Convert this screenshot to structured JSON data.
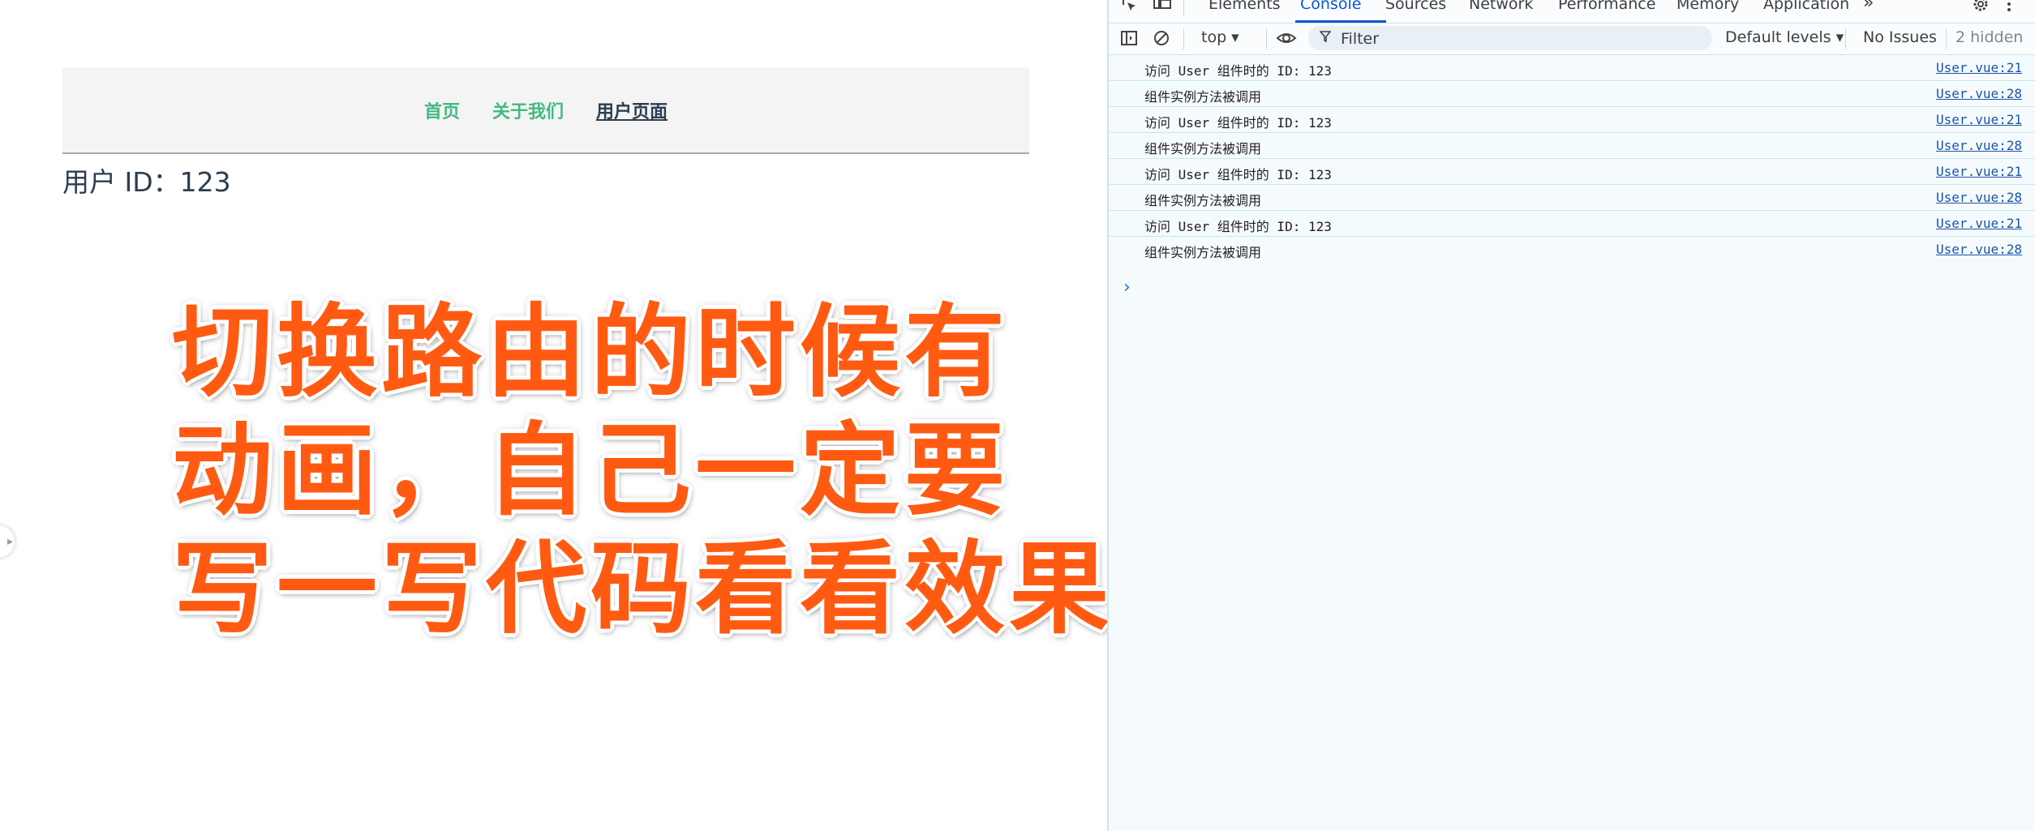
{
  "page": {
    "nav": {
      "home": "首页",
      "about": "关于我们",
      "user": "用户页面"
    },
    "user_id_text": "用户 ID：123",
    "overlay_lines": [
      "切换路由的时候有",
      "动画，自己一定要",
      "写一写代码看看效果"
    ]
  },
  "devtools": {
    "tabs": {
      "elements": "Elements",
      "console": "Console",
      "sources": "Sources",
      "network": "Network",
      "performance": "Performance",
      "memory": "Memory",
      "application": "Application",
      "more": "»"
    },
    "toolbar": {
      "context": "top",
      "filter_placeholder": "Filter",
      "levels": "Default levels",
      "issues": "No Issues",
      "hidden": "2 hidden"
    },
    "logs": [
      {
        "msg": "访问 User 组件时的 ID: 123",
        "src": "User.vue:21"
      },
      {
        "msg": "组件实例方法被调用",
        "src": "User.vue:28"
      },
      {
        "msg": "访问 User 组件时的 ID: 123",
        "src": "User.vue:21"
      },
      {
        "msg": "组件实例方法被调用",
        "src": "User.vue:28"
      },
      {
        "msg": "访问 User 组件时的 ID: 123",
        "src": "User.vue:21"
      },
      {
        "msg": "组件实例方法被调用",
        "src": "User.vue:28"
      },
      {
        "msg": "访问 User 组件时的 ID: 123",
        "src": "User.vue:21"
      },
      {
        "msg": "组件实例方法被调用",
        "src": "User.vue:28"
      }
    ],
    "icons": {
      "inspect": "inspect-element-icon",
      "device": "device-toolbar-icon",
      "sidebar": "sidebar-toggle-icon",
      "clear": "clear-console-icon",
      "eye": "live-expression-icon",
      "settings": "settings-gear-icon",
      "kebab": "more-options-icon",
      "prompt": "console-prompt-icon"
    }
  }
}
